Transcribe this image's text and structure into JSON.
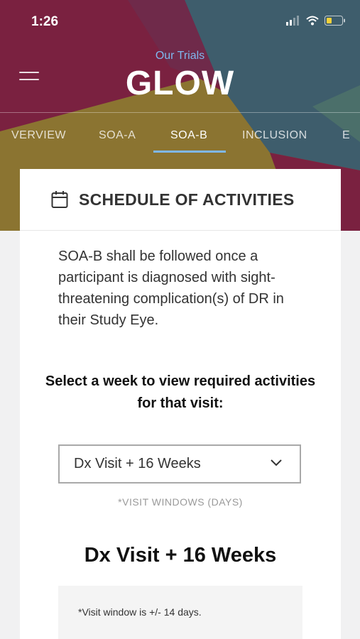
{
  "status_bar": {
    "time": "1:26"
  },
  "header": {
    "subtitle": "Our Trials",
    "title": "GLOW"
  },
  "tabs": [
    {
      "label": "VERVIEW"
    },
    {
      "label": "SOA-A"
    },
    {
      "label": "SOA-B",
      "active": true
    },
    {
      "label": "INCLUSION"
    },
    {
      "label": "E"
    }
  ],
  "card": {
    "title": "SCHEDULE OF ACTIVITIES",
    "icon": "calendar-icon",
    "description": "SOA-B shall be followed once a participant is diagnosed with sight-threatening complication(s) of DR in their Study Eye.",
    "prompt": "Select a week to view required activities for that visit:",
    "select": {
      "value": "Dx Visit + 16 Weeks"
    },
    "window_label": "*VISIT WINDOWS (DAYS)",
    "visit_title": "Dx Visit + 16 Weeks",
    "note": "*Visit window is +/- 14 days."
  },
  "colors": {
    "maroon": "#7a2140",
    "olive": "#8b7431",
    "slate": "#3e5d6c",
    "accent_blue": "#7fb8ee"
  }
}
